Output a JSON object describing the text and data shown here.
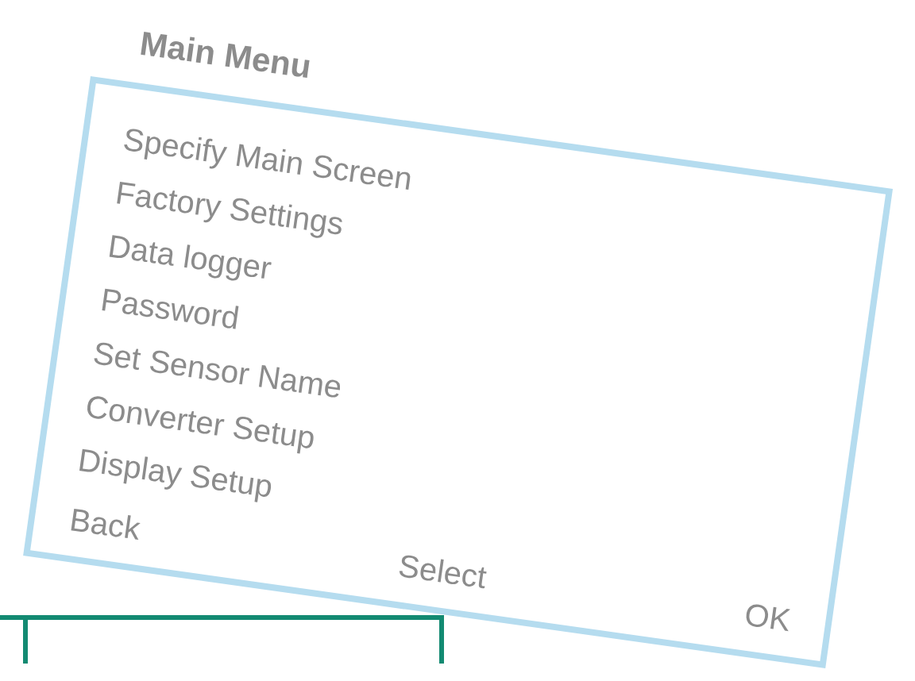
{
  "title": "Main Menu",
  "menu_items": [
    "Specify Main Screen",
    "Factory Settings",
    "Data logger",
    "Password",
    "Set Sensor Name",
    "Converter Setup",
    "Display Setup"
  ],
  "soft_keys": [
    "Back",
    "Select",
    "OK"
  ]
}
